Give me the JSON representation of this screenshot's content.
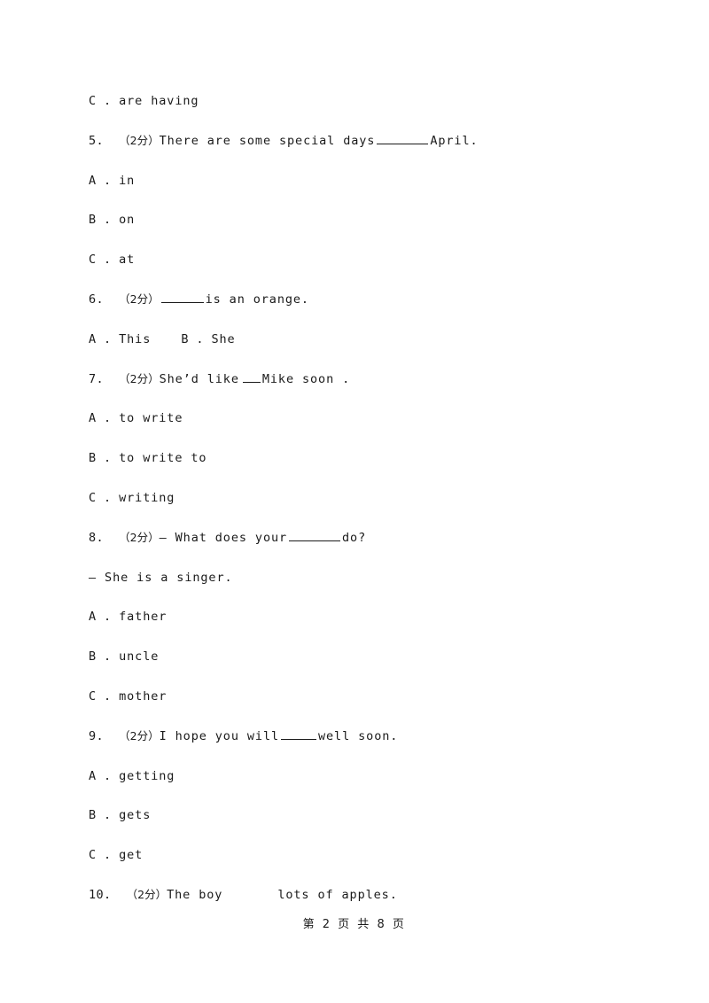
{
  "document": {
    "language": "zh-CN / en",
    "score_marker": "（2分）",
    "dash": "—"
  },
  "carryover_option": {
    "letter": "C .",
    "text": "are having"
  },
  "questions": [
    {
      "number": "5.",
      "score": "（2分）",
      "stem_before": "There are some special days",
      "blank": "long",
      "stem_after": "April.",
      "options": [
        {
          "letter": "A .",
          "text": "in"
        },
        {
          "letter": "B .",
          "text": "on"
        },
        {
          "letter": "C .",
          "text": "at"
        }
      ]
    },
    {
      "number": "6.",
      "score": "（2分）",
      "stem_before": "",
      "blank": "med",
      "stem_after": "is an orange.",
      "options_inline": [
        {
          "letter": "A .",
          "text": "This"
        },
        {
          "letter": "B .",
          "text": "She"
        }
      ]
    },
    {
      "number": "7.",
      "score": "（2分）",
      "stem_before": "She’d like",
      "blank": "tiny",
      "stem_after": "Mike soon .",
      "options": [
        {
          "letter": "A .",
          "text": "to write"
        },
        {
          "letter": "B .",
          "text": "to write to"
        },
        {
          "letter": "C .",
          "text": "writing"
        }
      ]
    },
    {
      "number": "8.",
      "score": "（2分）",
      "stem_before": "— What does your",
      "blank": "long",
      "stem_after": "do?",
      "answer_line": "— She is a singer.",
      "options": [
        {
          "letter": "A .",
          "text": "father"
        },
        {
          "letter": "B .",
          "text": "uncle"
        },
        {
          "letter": "C .",
          "text": "mother"
        }
      ]
    },
    {
      "number": "9.",
      "score": "（2分）",
      "stem_before": "I hope you will",
      "blank": "short",
      "stem_after": "well soon.",
      "options": [
        {
          "letter": "A .",
          "text": "getting"
        },
        {
          "letter": "B .",
          "text": "gets"
        },
        {
          "letter": "C .",
          "text": "get"
        }
      ]
    },
    {
      "number": "10.",
      "score": "（2分）",
      "stem_before": "The boy",
      "blank": "gap",
      "stem_after": "lots of apples."
    }
  ],
  "footer": {
    "text": "第 2 页 共 8 页"
  }
}
